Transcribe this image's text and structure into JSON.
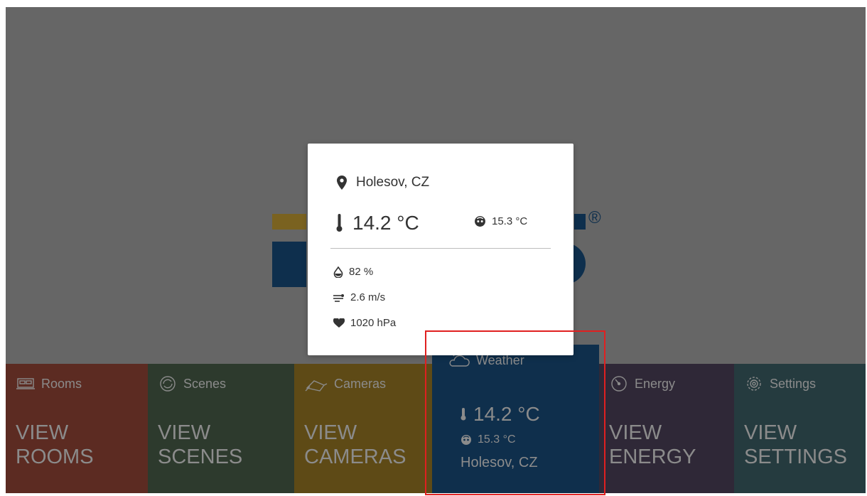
{
  "colors": {
    "background": "#666666",
    "popup": "#ffffff",
    "highlight": "#e02020",
    "tile_rooms": "#5c2b22",
    "tile_scenes": "#2d3a2d",
    "tile_cameras": "#5e4a16",
    "tile_weather": "#0f2f4c",
    "tile_energy": "#2f2837",
    "tile_settings": "#253b3f"
  },
  "logo": {
    "registered_mark": "®"
  },
  "popup": {
    "location": "Holesov, CZ",
    "temperature": "14.2 °C",
    "feels_like": "15.3 °C",
    "humidity": "82 %",
    "wind": "2.6 m/s",
    "pressure": "1020 hPa"
  },
  "tiles": [
    {
      "key": "rooms",
      "label": "Rooms",
      "icon": "bed-icon",
      "view": [
        "VIEW",
        "ROOMS"
      ]
    },
    {
      "key": "scenes",
      "label": "Scenes",
      "icon": "refresh-icon",
      "view": [
        "VIEW",
        "SCENES"
      ]
    },
    {
      "key": "cameras",
      "label": "Cameras",
      "icon": "camera-icon",
      "view": [
        "VIEW",
        "CAMERAS"
      ]
    },
    {
      "key": "weather",
      "label": "Weather",
      "icon": "cloud-sun-icon",
      "temperature": "14.2 °C",
      "feels_like": "15.3 °C",
      "location": "Holesov, CZ"
    },
    {
      "key": "energy",
      "label": "Energy",
      "icon": "gauge-icon",
      "view": [
        "VIEW",
        "ENERGY"
      ]
    },
    {
      "key": "settings",
      "label": "Settings",
      "icon": "gear-icon",
      "view": [
        "VIEW",
        "SETTINGS"
      ]
    }
  ]
}
